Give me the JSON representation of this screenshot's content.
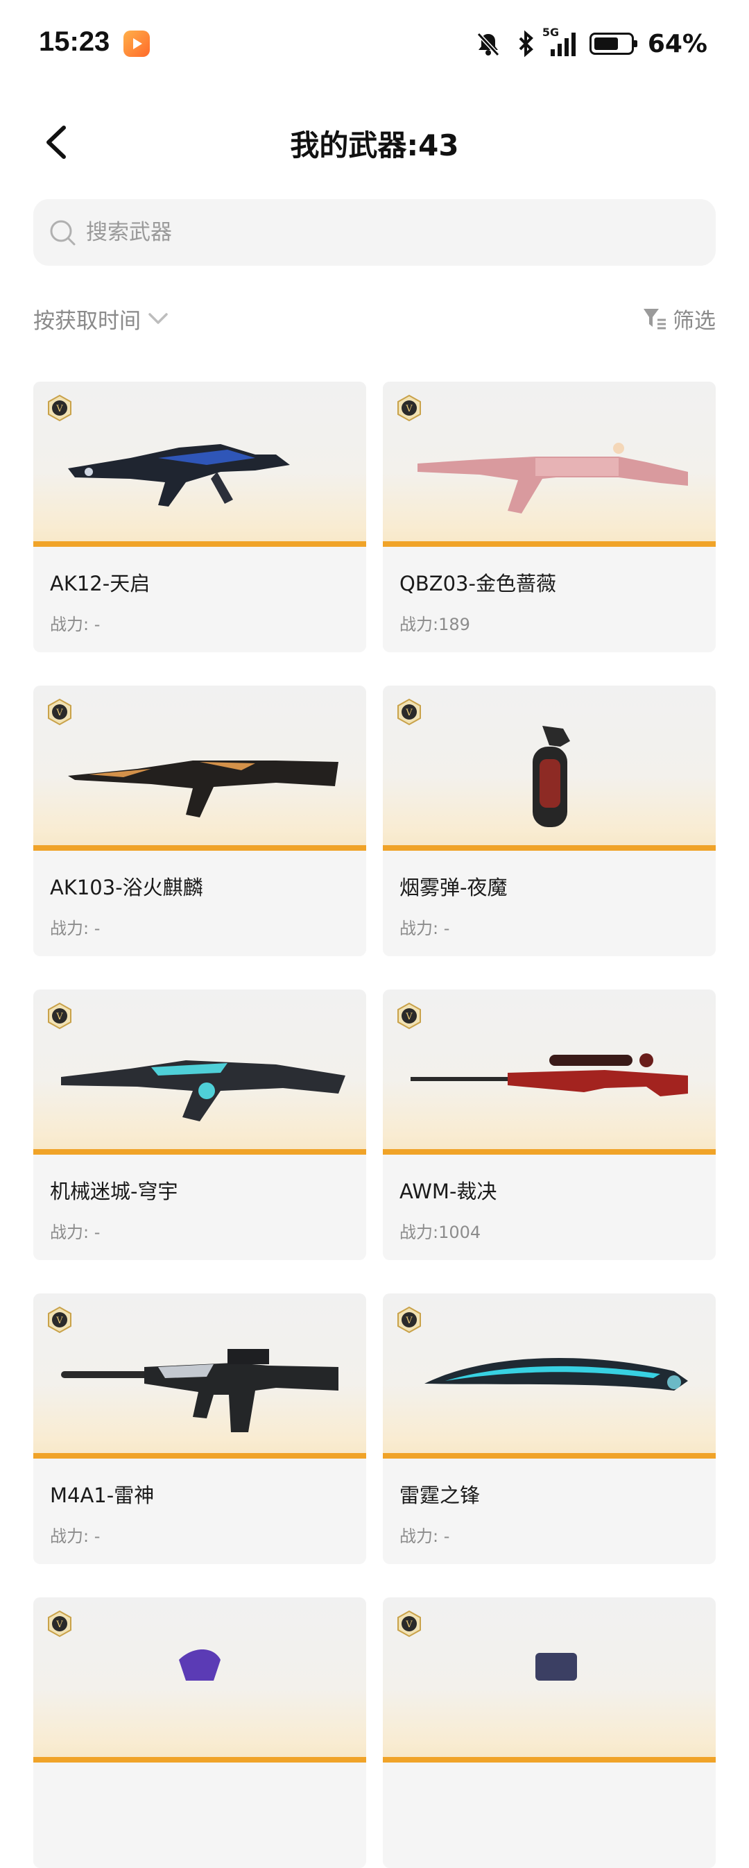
{
  "status_bar": {
    "time": "15:23",
    "network": "5G",
    "battery_percent": "64%",
    "icons": [
      "app-notification-icon",
      "mute-icon",
      "bluetooth-icon",
      "signal-icon",
      "battery-icon"
    ]
  },
  "header": {
    "title": "我的武器:43",
    "back_icon": "back-arrow-icon"
  },
  "search": {
    "placeholder": "搜索武器",
    "value": ""
  },
  "toolbar": {
    "sort_label": "按获取时间",
    "filter_label": "筛选"
  },
  "colors": {
    "accent_bar": "#f0a328",
    "card_bg": "#f5f5f5",
    "badge_gold": "#c9a24a"
  },
  "weapons": [
    {
      "name": "AK12-天启",
      "power": "战力: -"
    },
    {
      "name": "QBZ03-金色蔷薇",
      "power": "战力:189"
    },
    {
      "name": "AK103-浴火麒麟",
      "power": "战力: -"
    },
    {
      "name": "烟雾弹-夜魔",
      "power": "战力: -"
    },
    {
      "name": "机械迷城-穹宇",
      "power": "战力: -"
    },
    {
      "name": "AWM-裁决",
      "power": "战力:1004"
    },
    {
      "name": "M4A1-雷神",
      "power": "战力: -"
    },
    {
      "name": "雷霆之锋",
      "power": "战力: -"
    },
    {
      "name": "",
      "power": ""
    },
    {
      "name": "",
      "power": ""
    }
  ]
}
